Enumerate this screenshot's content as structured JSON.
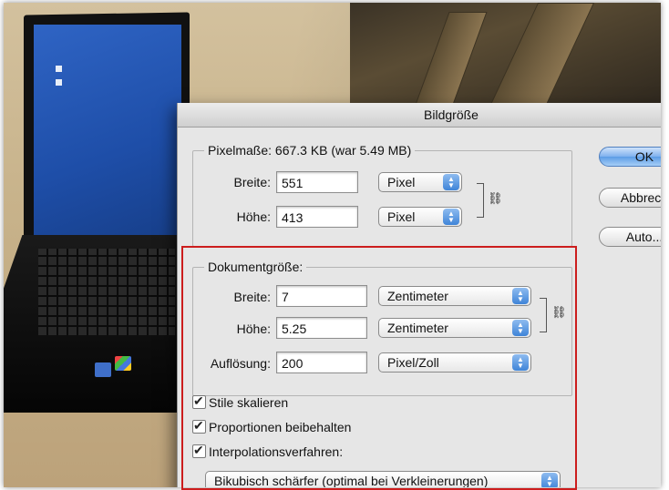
{
  "dialog": {
    "title": "Bildgröße",
    "pixel_dimensions": {
      "legend": "Pixelmaße: 667.3 KB (war 5.49 MB)",
      "width_label": "Breite:",
      "width_value": "551",
      "width_unit": "Pixel",
      "height_label": "Höhe:",
      "height_value": "413",
      "height_unit": "Pixel"
    },
    "document_size": {
      "legend": "Dokumentgröße:",
      "width_label": "Breite:",
      "width_value": "7",
      "width_unit": "Zentimeter",
      "height_label": "Höhe:",
      "height_value": "5.25",
      "height_unit": "Zentimeter",
      "resolution_label": "Auflösung:",
      "resolution_value": "200",
      "resolution_unit": "Pixel/Zoll"
    },
    "checkboxes": [
      {
        "label": "Stile skalieren",
        "checked": true
      },
      {
        "label": "Proportionen beibehalten",
        "checked": true
      },
      {
        "label": "Interpolationsverfahren:",
        "checked": true
      }
    ],
    "interpolation_value": "Bikubisch schärfer (optimal bei Verkleinerungen)",
    "buttons": {
      "ok": "OK",
      "cancel": "Abbrech",
      "auto": "Auto..."
    }
  },
  "colors": {
    "highlight_border": "#cc1d1d",
    "default_button": "#5c9ce6",
    "popup_arrows": "#3f84d8"
  },
  "icons": [
    "link-chain-icon",
    "popup-arrows-icon",
    "checkmark-icon"
  ]
}
